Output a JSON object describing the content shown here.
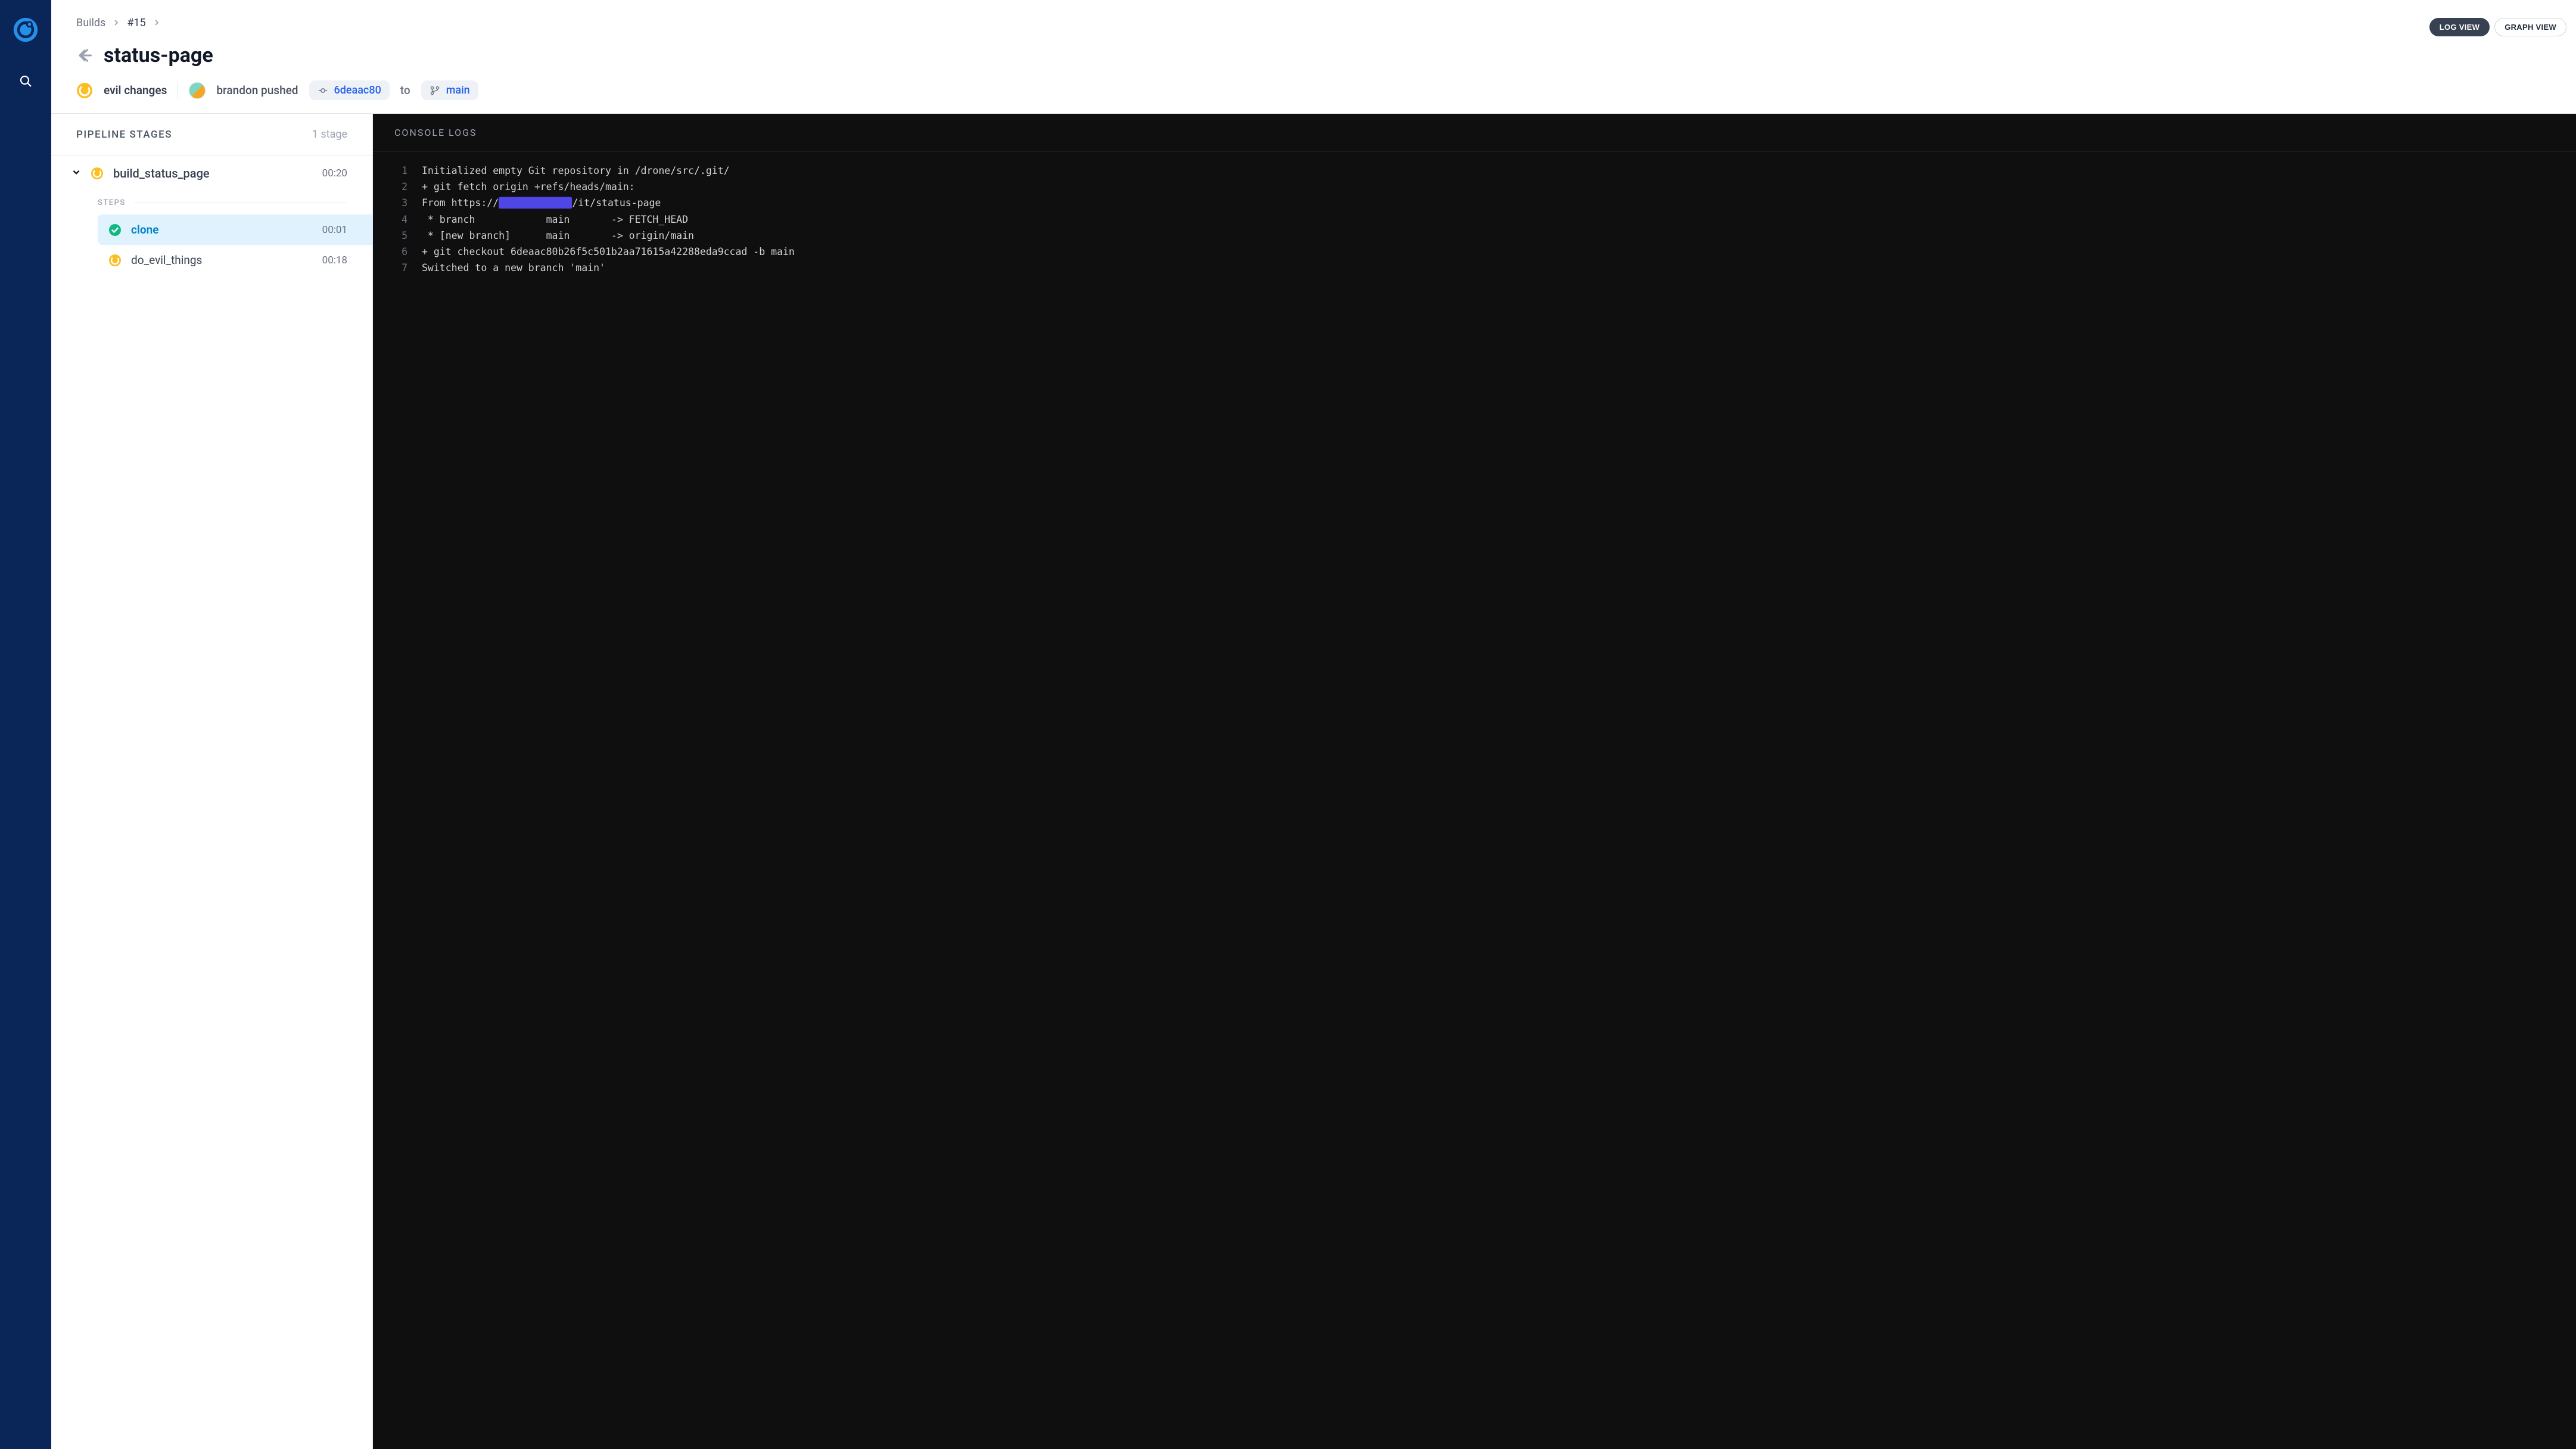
{
  "breadcrumb": {
    "root": "Builds",
    "id": "#15"
  },
  "view_toggles": {
    "log": "LOG VIEW",
    "graph": "GRAPH VIEW"
  },
  "title": "status-page",
  "commit": {
    "message": "evil changes",
    "author": "brandon",
    "action": "pushed",
    "hash": "6deaac80",
    "to_word": "to",
    "branch": "main"
  },
  "stages_header": {
    "title": "PIPELINE STAGES",
    "count": "1 stage"
  },
  "stage": {
    "name": "build_status_page",
    "duration": "00:20"
  },
  "steps_label": "STEPS",
  "steps": [
    {
      "name": "clone",
      "duration": "00:01",
      "status": "success"
    },
    {
      "name": "do_evil_things",
      "duration": "00:18",
      "status": "running"
    }
  ],
  "console_header": "CONSOLE LOGS",
  "logs": [
    {
      "n": "1",
      "text": "Initialized empty Git repository in /drone/src/.git/"
    },
    {
      "n": "2",
      "text": "+ git fetch origin +refs/heads/main:"
    },
    {
      "n": "3",
      "prefix": "From https://",
      "redacted": "████████████",
      "suffix": "/it/status-page"
    },
    {
      "n": "4",
      "text": " * branch            main       -> FETCH_HEAD"
    },
    {
      "n": "5",
      "text": " * [new branch]      main       -> origin/main"
    },
    {
      "n": "6",
      "text": "+ git checkout 6deaac80b26f5c501b2aa71615a42288eda9ccad -b main"
    },
    {
      "n": "7",
      "text": "Switched to a new branch 'main'"
    }
  ]
}
